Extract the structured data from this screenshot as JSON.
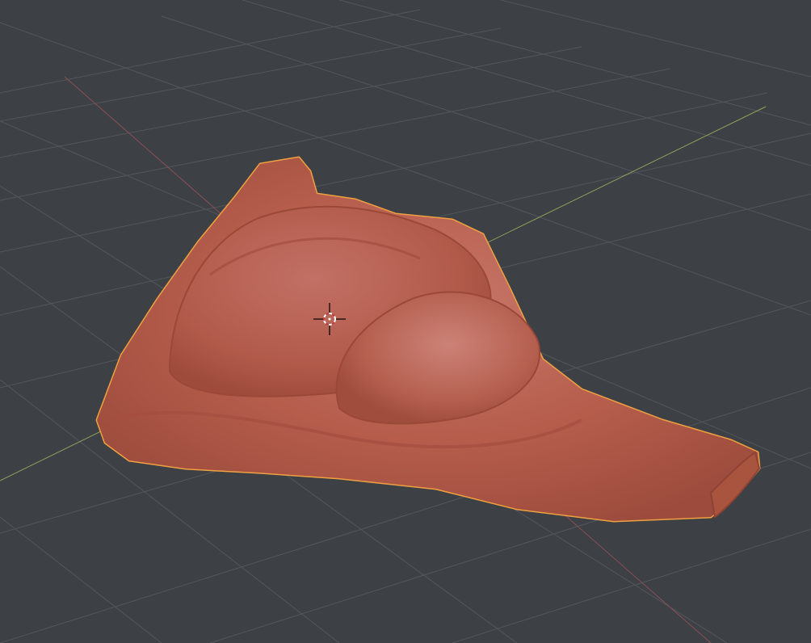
{
  "app": {
    "name": "3D viewport",
    "background_color": "#3d4045",
    "grid_color": "#53575d",
    "x_axis_color": "#8a4f55",
    "y_axis_color": "#8fa05a"
  },
  "object": {
    "kind": "sculpted mesh",
    "material_color": "#b65d4c",
    "selection_outline_color": "#f0a040",
    "selected": true
  },
  "cursor": {
    "icon": "3d-cursor-icon",
    "ring_colors": [
      "#ffffff",
      "#c04040"
    ]
  }
}
